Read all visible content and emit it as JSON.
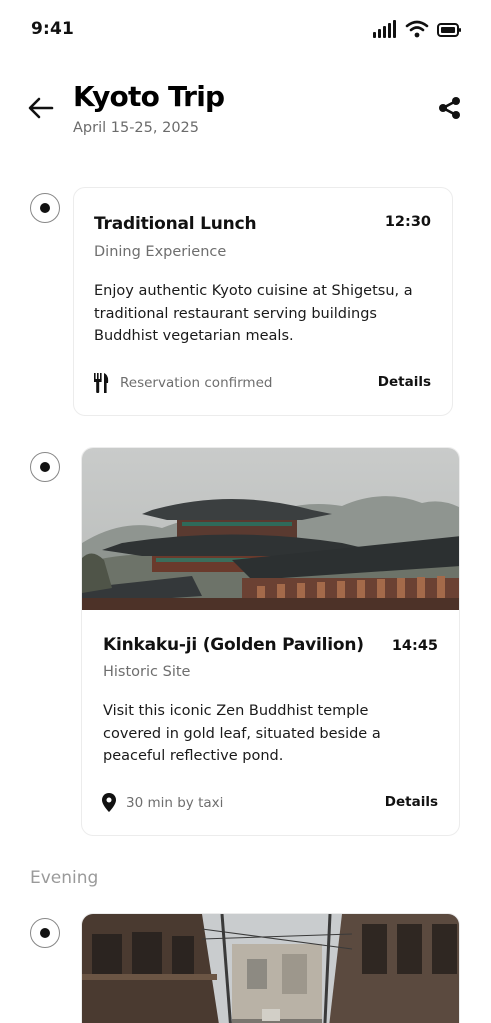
{
  "status_bar": {
    "time": "9:41",
    "icons": [
      "signal-icon",
      "wifi-icon",
      "battery-icon"
    ]
  },
  "header": {
    "back_icon": "arrow-left-icon",
    "title": "Kyoto Trip",
    "dates": "April 15-25, 2025",
    "share_icon": "share-icon"
  },
  "timeline": [
    {
      "title": "Traditional Lunch",
      "time": "12:30",
      "category": "Dining Experience",
      "description_lines": [
        "Enjoy authentic Kyoto cuisine at Shigetsu, a",
        "traditional restaurant serving buildings",
        "Buddhist vegetarian meals."
      ],
      "meta_icon": "utensils-icon",
      "meta_text": "Reservation confirmed",
      "link": "Details"
    },
    {
      "image": "pagoda-temple-photo",
      "title": "Kinkaku-ji (Golden Pavilion)",
      "time": "14:45",
      "category": "Historic Site",
      "description_lines": [
        "Visit this iconic Zen Buddhist temple",
        "covered in gold leaf, situated beside a",
        "peaceful reflective pond."
      ],
      "meta_icon": "map-pin-icon",
      "meta_text": "30 min by taxi",
      "link": "Details"
    },
    {
      "image": "kyoto-street-photo"
    }
  ],
  "sections": {
    "evening": "Evening"
  },
  "colors": {
    "text": "#111111",
    "muted": "#6e6e6e",
    "border": "#ececec"
  }
}
